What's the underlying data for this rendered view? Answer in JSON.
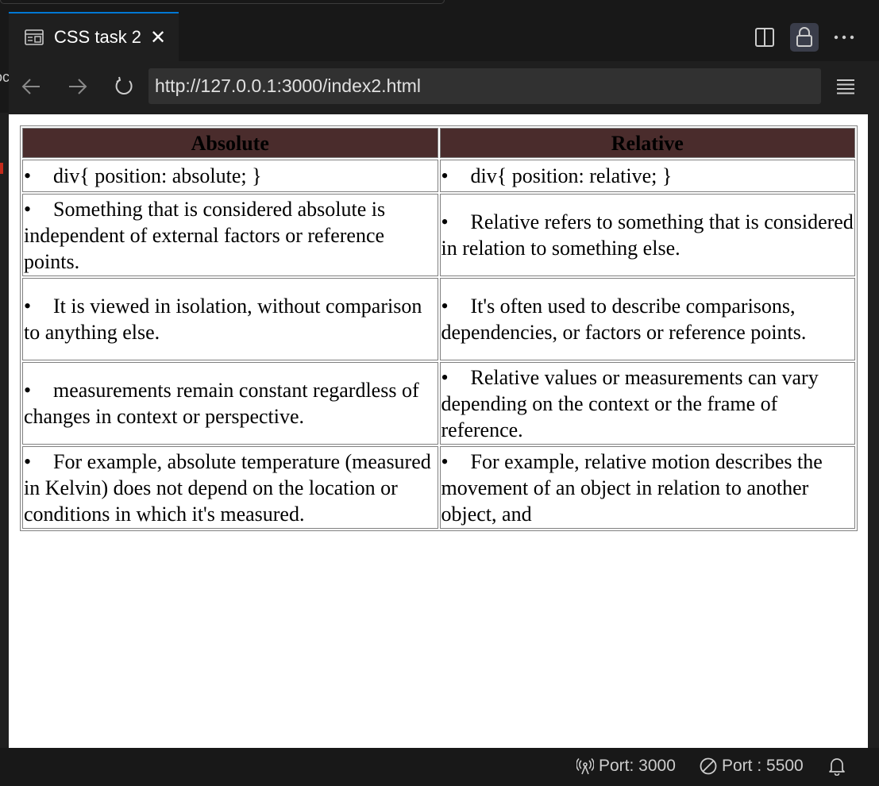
{
  "tab": {
    "title": "CSS task 2",
    "close": "✕"
  },
  "nav": {
    "url": "http://127.0.0.1:3000/index2.html"
  },
  "left_edge_text": "oc",
  "table": {
    "headers": [
      "Absolute",
      "Relative"
    ],
    "rows": [
      [
        "div{ position: absolute; }",
        "div{ position: relative; }"
      ],
      [
        "Something that is considered absolute is independent of external factors or reference points.",
        "Relative refers to something that is considered in relation to something else."
      ],
      [
        "It is viewed in isolation, without comparison to anything else.",
        "It's often used to describe comparisons, dependencies, or factors or reference points."
      ],
      [
        "measurements remain constant regardless of changes in context or perspective.",
        "Relative values or measurements can vary depending on the context or the frame of reference."
      ],
      [
        "For example, absolute temperature (measured in Kelvin) does not depend on the location or conditions in which it's measured.",
        "For example, relative motion describes the movement of an object in relation to another object, and"
      ]
    ],
    "bullet": "•"
  },
  "status": {
    "port1": "Port: 3000",
    "port2": "Port : 5500"
  },
  "colors": {
    "accent": "#0078d4",
    "header_bg": "#4a2c2c"
  }
}
